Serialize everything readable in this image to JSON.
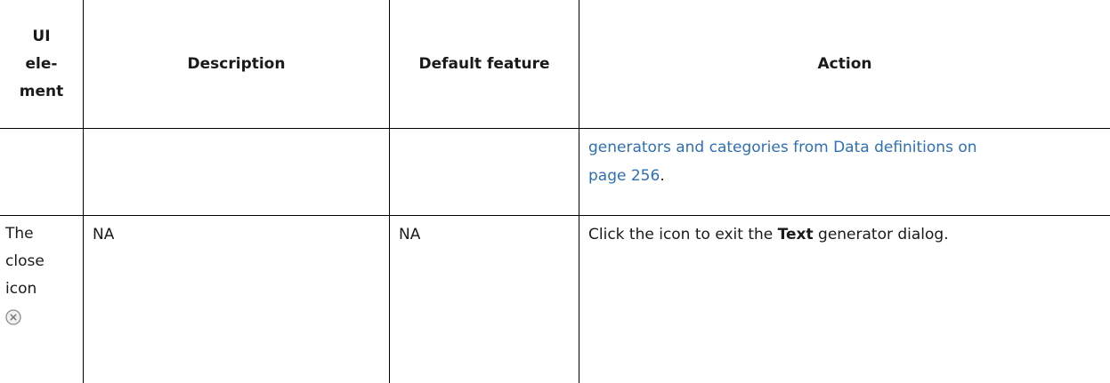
{
  "table": {
    "headers": {
      "ui_element": "UI ele-ment",
      "ui_element_lines": [
        "UI",
        "ele-",
        "ment"
      ],
      "description": "Description",
      "default_feature": "Default feature",
      "action": "Action"
    },
    "rows": [
      {
        "ui_element": "",
        "description": "",
        "default_feature": "",
        "action": {
          "link_line1": "generators and categories from Data definitions on",
          "link_line2": "page 256",
          "suffix": "."
        }
      },
      {
        "ui_element": "The close icon",
        "ui_element_lines": [
          "The",
          "close",
          "icon"
        ],
        "icon": "close-circle-icon",
        "description": "NA",
        "default_feature": "NA",
        "action": {
          "prefix": "Click the icon to exit the ",
          "bold": "Text",
          "suffix": " generator dialog."
        }
      }
    ]
  },
  "colors": {
    "link": "#2f6fb3",
    "border": "#000000",
    "icon": "#8a8a8a"
  }
}
